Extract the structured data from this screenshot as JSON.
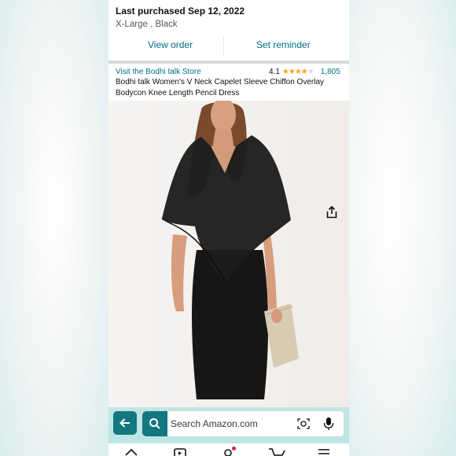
{
  "order": {
    "title": "Last purchased Sep 12, 2022",
    "variant": "X-Large , Black",
    "view_label": "View order",
    "reminder_label": "Set reminder"
  },
  "product": {
    "store_link": "Visit the Bodhi talk Store",
    "rating": "4.1",
    "stars": 4.1,
    "review_count": "1,805",
    "title": "Bodhi talk Women's V Neck Capelet Sleeve Chiffon Overlay Bodycon Knee Length Pencil Dress"
  },
  "search": {
    "placeholder": "Search Amazon.com"
  },
  "colors": {
    "link": "#007185",
    "accent": "#12777f",
    "search_bar_bg": "#bfe6e6",
    "star": "#ffa41c"
  },
  "icons": [
    "share-icon",
    "back-arrow-icon",
    "search-icon",
    "camera-icon",
    "microphone-icon",
    "home-icon",
    "video-icon",
    "profile-icon",
    "cart-icon",
    "menu-icon"
  ]
}
